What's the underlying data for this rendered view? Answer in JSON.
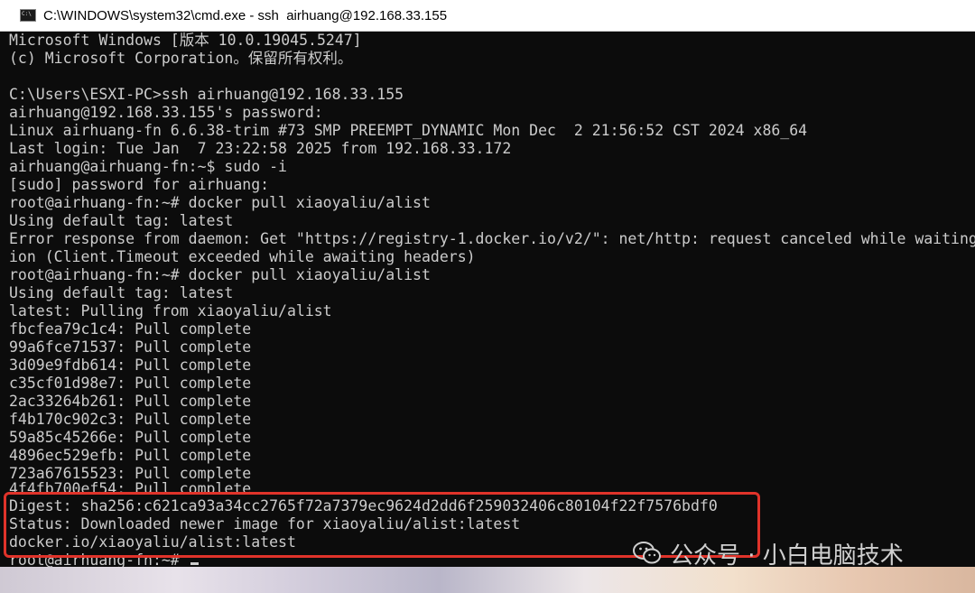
{
  "window": {
    "title": "C:\\WINDOWS\\system32\\cmd.exe - ssh  airhuang@192.168.33.155"
  },
  "terminal": {
    "lines": [
      "Microsoft Windows [版本 10.0.19045.5247]",
      "(c) Microsoft Corporation。保留所有权利。",
      "",
      "C:\\Users\\ESXI-PC>ssh airhuang@192.168.33.155",
      "airhuang@192.168.33.155's password:",
      "Linux airhuang-fn 6.6.38-trim #73 SMP PREEMPT_DYNAMIC Mon Dec  2 21:56:52 CST 2024 x86_64",
      "Last login: Tue Jan  7 23:22:58 2025 from 192.168.33.172",
      "airhuang@airhuang-fn:~$ sudo -i",
      "[sudo] password for airhuang:",
      "root@airhuang-fn:~# docker pull xiaoyaliu/alist",
      "Using default tag: latest",
      "Error response from daemon: Get \"https://registry-1.docker.io/v2/\": net/http: request canceled while waiting",
      "ion (Client.Timeout exceeded while awaiting headers)",
      "root@airhuang-fn:~# docker pull xiaoyaliu/alist",
      "Using default tag: latest",
      "latest: Pulling from xiaoyaliu/alist",
      "fbcfea79c1c4: Pull complete",
      "99a6fce71537: Pull complete",
      "3d09e9fdb614: Pull complete",
      "c35cf01d98e7: Pull complete",
      "2ac33264b261: Pull complete",
      "f4b170c902c3: Pull complete",
      "59a85c45266e: Pull complete",
      "4896ec529efb: Pull complete",
      "723a67615523: Pull complete",
      "4f4fb700ef54: Pull complete",
      "Digest: sha256:c621ca93a34cc2765f72a7379ec9624d2dd6f259032406c80104f22f7576bdf0",
      "Status: Downloaded newer image for xiaoyaliu/alist:latest",
      "docker.io/xiaoyaliu/alist:latest"
    ],
    "prompt": "root@airhuang-fn:~# "
  },
  "watermark": {
    "text": "公众号 · 小白电脑技术",
    "icon": "wechat-icon"
  },
  "colors": {
    "console_bg": "#0c0c0c",
    "console_fg": "#cccccc",
    "highlight": "#e0332a"
  }
}
